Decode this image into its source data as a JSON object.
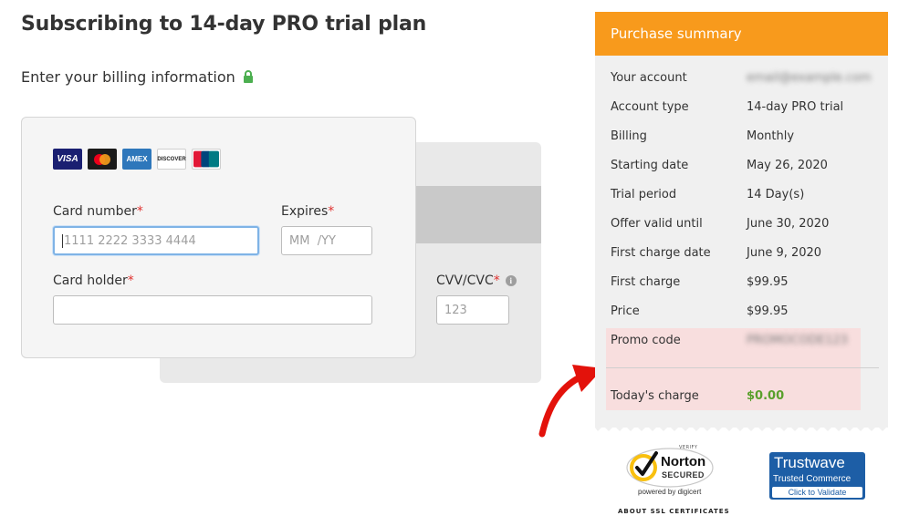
{
  "page": {
    "title": "Subscribing to 14-day PRO trial plan",
    "billing_heading": "Enter your billing information"
  },
  "card_brands": [
    "VISA",
    "Mastercard",
    "AMEX",
    "DISCOVER",
    "UnionPay"
  ],
  "form": {
    "card_number": {
      "label": "Card number",
      "required_mark": "*",
      "placeholder": "1111 2222 3333 4444"
    },
    "expires": {
      "label": "Expires",
      "required_mark": "*",
      "placeholder": "MM  /YY"
    },
    "card_holder": {
      "label": "Card holder",
      "required_mark": "*",
      "placeholder": ""
    },
    "cvv": {
      "label": "CVV/CVC",
      "required_mark": "*",
      "placeholder": "123"
    }
  },
  "summary": {
    "header": "Purchase summary",
    "rows": [
      {
        "label": "Your account",
        "value": "email@example.com",
        "blurred": true
      },
      {
        "label": "Account type",
        "value": "14-day PRO trial"
      },
      {
        "label": "Billing",
        "value": "Monthly"
      },
      {
        "label": "Starting date",
        "value": "May 26, 2020"
      },
      {
        "label": "Trial period",
        "value": "14 Day(s)"
      },
      {
        "label": "Offer valid until",
        "value": "June 30, 2020"
      },
      {
        "label": "First charge date",
        "value": "June 9, 2020"
      },
      {
        "label": "First charge",
        "value": "$99.95"
      },
      {
        "label": "Price",
        "value": "$99.95"
      },
      {
        "label": "Promo code",
        "value": "PROMOCODE123",
        "blurred": true
      }
    ],
    "todays_charge": {
      "label": "Today's charge",
      "value": "$0.00"
    }
  },
  "badges": {
    "norton": {
      "verify": "VERIFY",
      "name": "Norton",
      "secured": "SECURED",
      "powered": "powered by digicert"
    },
    "about_ssl": "ABOUT SSL CERTIFICATES",
    "trustwave": {
      "name": "Trustwave",
      "subtitle": "Trusted Commerce",
      "button": "Click to Validate"
    }
  },
  "colors": {
    "accent_orange": "#f89a1c",
    "promo_highlight": "#f8dede",
    "charge_green": "#5aa02c",
    "required_red": "#e0312f",
    "arrow_red": "#e3120b"
  }
}
